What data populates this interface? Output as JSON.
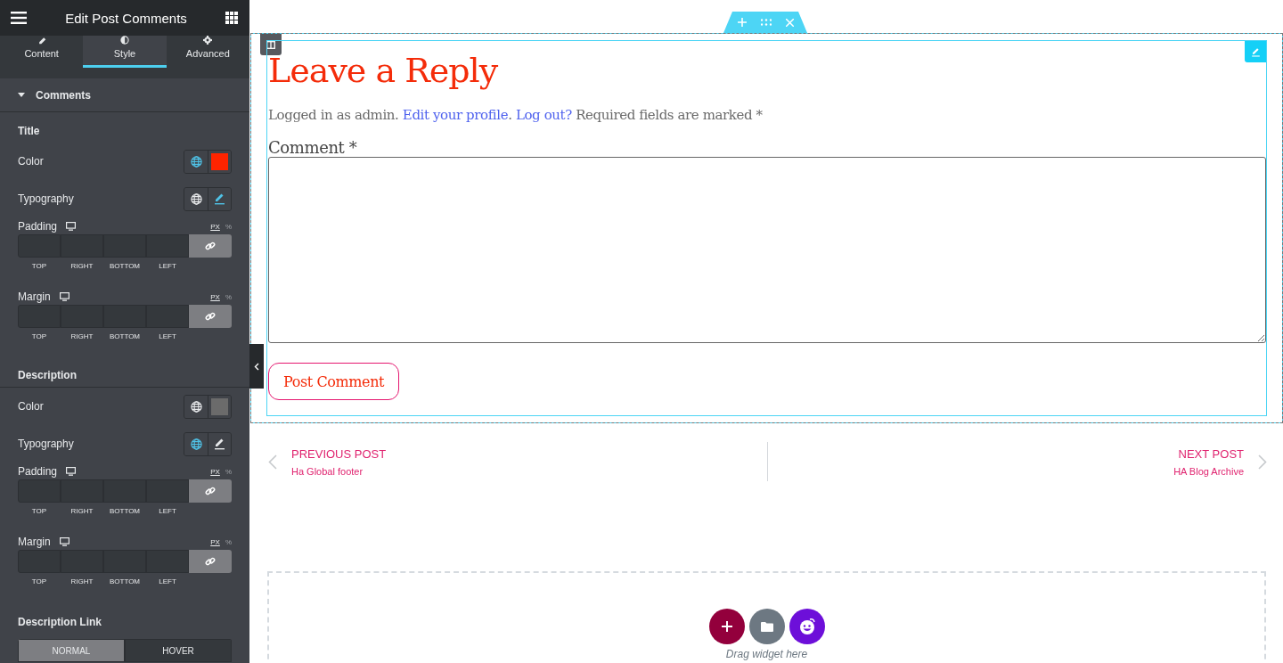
{
  "sidebar": {
    "title": "Edit Post Comments",
    "tabs": [
      {
        "label": "Content",
        "selected": false
      },
      {
        "label": "Style",
        "selected": true
      },
      {
        "label": "Advanced",
        "selected": false
      }
    ],
    "section": {
      "title": "Comments",
      "expanded": true
    },
    "groups": [
      {
        "heading": "Title",
        "separator": false,
        "controls": [
          {
            "kind": "color",
            "label": "Color",
            "global_active": true,
            "color": "#ff2400"
          },
          {
            "kind": "typography",
            "label": "Typography",
            "global_active": false,
            "edited": true
          },
          {
            "kind": "dimensions",
            "label": "Padding",
            "units": [
              {
                "label": "PX",
                "selected": true
              },
              {
                "label": "%",
                "selected": false
              }
            ],
            "sides": [
              "TOP",
              "RIGHT",
              "BOTTOM",
              "LEFT"
            ],
            "linked": true
          },
          {
            "kind": "dimensions",
            "label": "Margin",
            "units": [
              {
                "label": "PX",
                "selected": true
              },
              {
                "label": "%",
                "selected": false
              }
            ],
            "sides": [
              "TOP",
              "RIGHT",
              "BOTTOM",
              "LEFT"
            ],
            "linked": true
          }
        ]
      },
      {
        "heading": "Description",
        "separator": true,
        "controls": [
          {
            "kind": "color",
            "label": "Color",
            "global_active": false,
            "color": "#6b6b6b"
          },
          {
            "kind": "typography",
            "label": "Typography",
            "global_active": true,
            "edited": false
          },
          {
            "kind": "dimensions",
            "label": "Padding",
            "units": [
              {
                "label": "PX",
                "selected": true
              },
              {
                "label": "%",
                "selected": false
              }
            ],
            "sides": [
              "TOP",
              "RIGHT",
              "BOTTOM",
              "LEFT"
            ],
            "linked": true
          },
          {
            "kind": "dimensions",
            "label": "Margin",
            "units": [
              {
                "label": "PX",
                "selected": true
              },
              {
                "label": "%",
                "selected": false
              }
            ],
            "sides": [
              "TOP",
              "RIGHT",
              "BOTTOM",
              "LEFT"
            ],
            "linked": true
          }
        ]
      },
      {
        "heading": "Description Link",
        "separator": false,
        "controls": [
          {
            "kind": "state_tabs",
            "tabs": [
              {
                "label": "NORMAL",
                "selected": true
              },
              {
                "label": "HOVER",
                "selected": false
              }
            ]
          }
        ]
      }
    ]
  },
  "comment_form": {
    "title": "Leave a Reply",
    "notice": [
      {
        "kind": "text",
        "text": "Logged in as admin. "
      },
      {
        "kind": "link",
        "text": "Edit your profile"
      },
      {
        "kind": "text",
        "text": ". "
      },
      {
        "kind": "link",
        "text": "Log out?"
      },
      {
        "kind": "text",
        "text": " Required fields are marked *"
      }
    ],
    "comment_label": "Comment *",
    "submit": "Post Comment"
  },
  "post_navigation": {
    "previous": {
      "label": "PREVIOUS POST",
      "title": "Ha Global footer"
    },
    "next": {
      "label": "NEXT POST",
      "title": "HA Blog Archive"
    }
  },
  "drop_zone": {
    "hint": "Drag widget here"
  }
}
